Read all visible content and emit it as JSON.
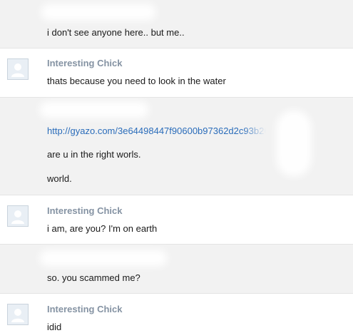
{
  "messages": [
    {
      "lines": [
        "i don't see anyone here.. but me.."
      ]
    },
    {
      "sender": "Interesting Chick",
      "lines": [
        "thats because you need to look in the water"
      ]
    },
    {
      "lines": [
        "http://gyazo.com/3e64498447f90600b97362d2c93b2668",
        "are u in the right worls.",
        "world."
      ]
    },
    {
      "sender": "Interesting Chick",
      "lines": [
        "i am, are you? I'm on earth"
      ]
    },
    {
      "lines": [
        "so. you scammed me?"
      ]
    },
    {
      "sender": "Interesting Chick",
      "lines": [
        "idid"
      ]
    }
  ],
  "colors": {
    "gray_row": "#f2f2f2",
    "name": "#8593a3",
    "link": "#2a6cba"
  },
  "icons": {
    "avatar": "default-user-avatar-icon"
  }
}
